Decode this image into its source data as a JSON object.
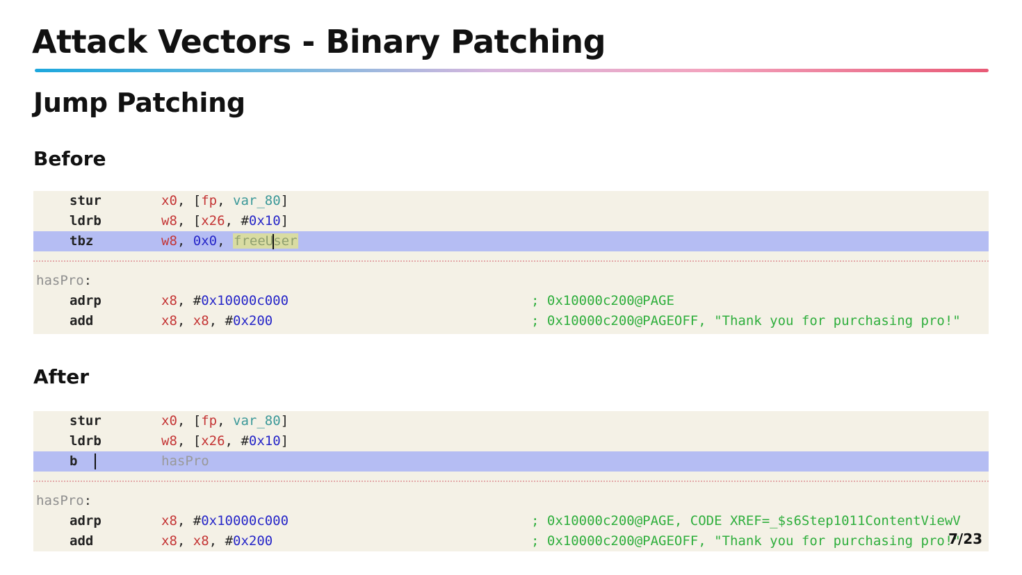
{
  "slide": {
    "title": "Attack Vectors - Binary Patching",
    "section": "Jump Patching",
    "page_number": "7/23"
  },
  "before": {
    "heading": "Before",
    "lines": [
      {
        "mnemonic": "stur",
        "op1": "x0",
        "op2": "fp",
        "op3": "var_80"
      },
      {
        "mnemonic": "ldrb",
        "op1": "w8",
        "op2": "x26",
        "op3": "#",
        "op3_num": "0x10"
      },
      {
        "mnemonic": "tbz",
        "op1": "w8",
        "op2": "0x0",
        "op3_a": "freeU",
        "op3_b": "ser",
        "selected": true
      },
      {
        "label": "hasPro"
      },
      {
        "mnemonic": "adrp",
        "op1": "x8",
        "op2": "#",
        "op2_num": "0x10000c000",
        "comment": "; 0x10000c200@PAGE"
      },
      {
        "mnemonic": "add",
        "op1": "x8",
        "op2": "x8",
        "op3": "#",
        "op3_num": "0x200",
        "comment": "; 0x10000c200@PAGEOFF, \"Thank you for purchasing pro!\""
      }
    ]
  },
  "after": {
    "heading": "After",
    "lines": [
      {
        "mnemonic": "stur",
        "op1": "x0",
        "op2": "fp",
        "op3": "var_80"
      },
      {
        "mnemonic": "ldrb",
        "op1": "w8",
        "op2": "x26",
        "op3": "#",
        "op3_num": "0x10"
      },
      {
        "mnemonic": "b",
        "target": "hasPro",
        "selected": true
      },
      {
        "label": "hasPro"
      },
      {
        "mnemonic": "adrp",
        "op1": "x8",
        "op2": "#",
        "op2_num": "0x10000c000",
        "comment": "; 0x10000c200@PAGE, CODE XREF=_$s6Step1011ContentViewV"
      },
      {
        "mnemonic": "add",
        "op1": "x8",
        "op2": "x8",
        "op3": "#",
        "op3_num": "0x200",
        "comment": "; 0x10000c200@PAGEOFF, \"Thank you for purchasing pro!\""
      }
    ]
  },
  "colors": {
    "code_background": "#f4f1e6",
    "selection": "#b5bdf3",
    "register": "#c43434",
    "number": "#2626c8",
    "comment": "#2eae3c",
    "symbol": "#3b9898",
    "label": "#8e8e8e"
  }
}
